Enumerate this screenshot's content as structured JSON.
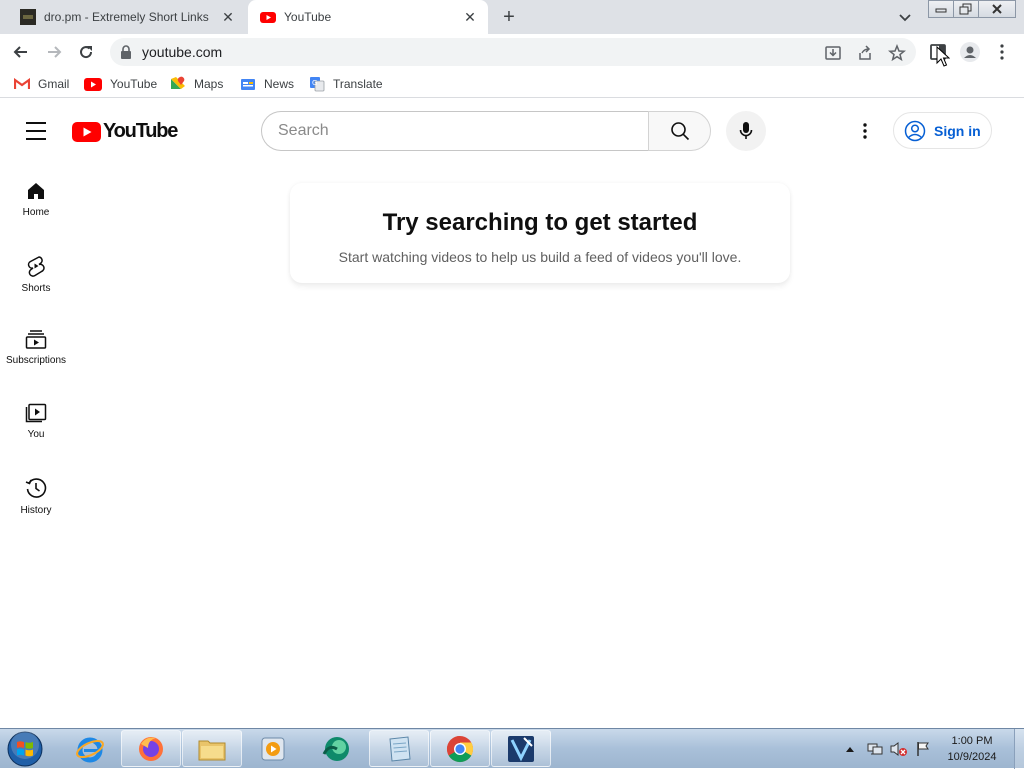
{
  "browser": {
    "tabs": [
      {
        "title": "dro.pm - Extremely Short Links",
        "active": false
      },
      {
        "title": "YouTube",
        "active": true
      }
    ],
    "url": "youtube.com",
    "bookmarks": [
      {
        "label": "Gmail",
        "icon": "gmail-icon"
      },
      {
        "label": "YouTube",
        "icon": "youtube-icon"
      },
      {
        "label": "Maps",
        "icon": "maps-icon"
      },
      {
        "label": "News",
        "icon": "news-icon"
      },
      {
        "label": "Translate",
        "icon": "translate-icon"
      }
    ]
  },
  "youtube": {
    "logo_text": "YouTube",
    "search_placeholder": "Search",
    "sign_in": "Sign in",
    "sidebar": [
      {
        "label": "Home",
        "icon": "home-icon"
      },
      {
        "label": "Shorts",
        "icon": "shorts-icon"
      },
      {
        "label": "Subscriptions",
        "icon": "subscriptions-icon"
      },
      {
        "label": "You",
        "icon": "you-icon"
      },
      {
        "label": "History",
        "icon": "history-icon"
      }
    ],
    "prompt": {
      "heading": "Try searching to get started",
      "body": "Start watching videos to help us build a feed of videos you'll love."
    }
  },
  "taskbar": {
    "apps": [
      "internet-explorer",
      "firefox",
      "file-explorer",
      "media-player",
      "app-teal",
      "app-notepad",
      "chrome",
      "app-blue"
    ],
    "time": "1:00 PM",
    "date": "10/9/2024"
  },
  "colors": {
    "youtube_red": "#ff0000",
    "link_blue": "#065fd4",
    "chrome_frame": "#dee1e6"
  }
}
